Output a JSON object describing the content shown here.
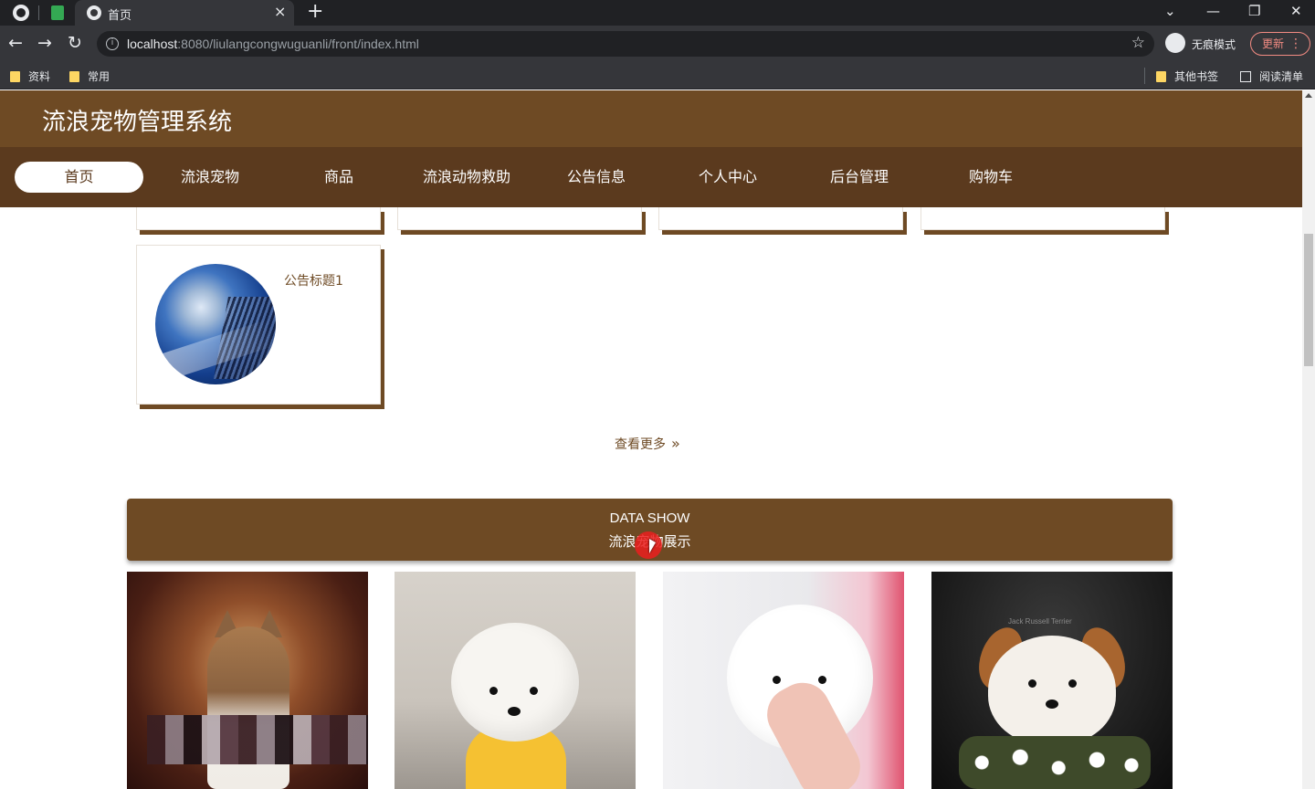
{
  "browser": {
    "tab_title": "首页",
    "tab_close": "×",
    "new_tab": "+",
    "url_host": "localhost",
    "url_rest": ":8080/liulangcongwuguanli/front/index.html",
    "incognito_label": "无痕模式",
    "update_label": "更新",
    "update_menu": "⋮",
    "bookmarks": [
      "资料",
      "常用"
    ],
    "bookmarks_right": [
      "其他书签",
      "阅读清单"
    ],
    "window_controls": [
      "⌄",
      "—",
      "❐",
      "✕"
    ],
    "nav_icons": {
      "back": "←",
      "forward": "→",
      "reload": "↻",
      "info": "i",
      "star": "☆"
    }
  },
  "site": {
    "title": "流浪宠物管理系统",
    "nav": [
      "首页",
      "流浪宠物",
      "商品",
      "流浪动物救助",
      "公告信息",
      "个人中心",
      "后台管理",
      "购物车"
    ],
    "active_nav": "首页"
  },
  "news": {
    "card_title": "公告标题1",
    "more_label": "查看更多",
    "more_icon": "»"
  },
  "section": {
    "english_title": "DATA SHOW",
    "chinese_title": "流浪宠物展示"
  },
  "pets": {
    "count": 4,
    "image_text": [
      "Jack Russell Terrier"
    ]
  },
  "colors": {
    "header_brown": "#6e4a24",
    "nav_brown": "#5b3a1e",
    "accent_text": "#6e4a24"
  }
}
